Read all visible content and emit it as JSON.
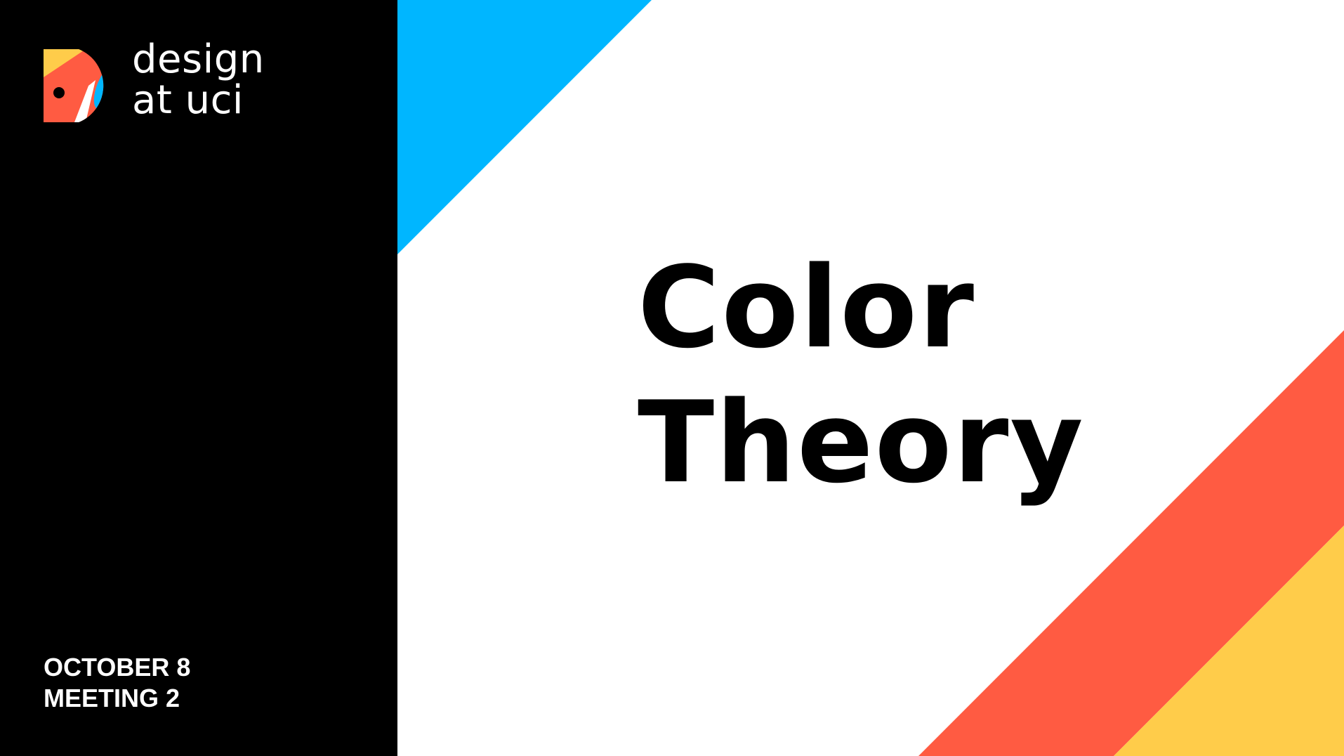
{
  "slide": {
    "brand": {
      "line1": "design",
      "line2": "at uci",
      "logo_icon": "design-at-uci-logo"
    },
    "meeting": {
      "date": "OCTOBER 8",
      "number": "MEETING 2"
    },
    "title": {
      "line1": "Color",
      "line2": "Theory"
    }
  },
  "colors": {
    "panel": "#000000",
    "background": "#ffffff",
    "blue": "#00b6ff",
    "red": "#ff5b42",
    "yellow": "#ffcc4a"
  }
}
